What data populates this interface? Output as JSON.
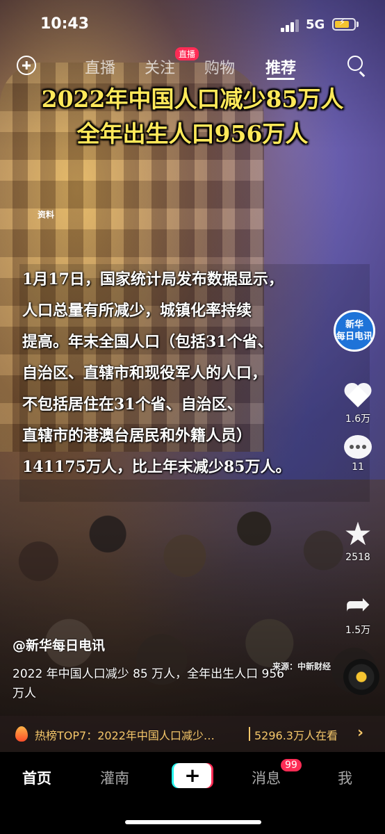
{
  "status_bar": {
    "time": "10:43",
    "network": "5G"
  },
  "top_nav": {
    "tabs": [
      "直播",
      "关注",
      "购物",
      "推荐"
    ],
    "live_badge": "直播",
    "active_tab": "推荐"
  },
  "video": {
    "headline_line1": "2022年中国人口减少85万人",
    "headline_line2": "全年出生人口956万人",
    "label_ziliao": "资料",
    "body": "1月17日，国家统计局发布数据显示，\n人口总量有所减少，城镇化率持续\n提高。年末全国人口（包括31个省、\n自治区、直辖市和现役军人的人口，\n不包括居住在31个省、自治区、\n直辖市的港澳台居民和外籍人员）\n141175万人，比上年末减少85万人。",
    "source": "来源：中新财经",
    "logo_line1": "新华",
    "logo_line2": "每日电讯"
  },
  "actions": {
    "likes": "1.6万",
    "comments": "11",
    "favorites": "2518",
    "shares": "1.5万"
  },
  "caption": {
    "author": "@新华每日电讯",
    "text": "2022 年中国人口减少 85 万人，全年出生人口 956 万人"
  },
  "hot_bar": {
    "text": "热榜TOP7：2022年中国人口减少…",
    "count": "5296.3万人在看",
    "chevron": "›"
  },
  "bottom_nav": {
    "home": "首页",
    "discover": "灌南",
    "create": "+",
    "messages": "消息",
    "messages_badge": "99",
    "me": "我"
  },
  "colors": {
    "headline": "#ffe95a",
    "accent": "#fe2c55",
    "hot": "#f5c76a"
  }
}
